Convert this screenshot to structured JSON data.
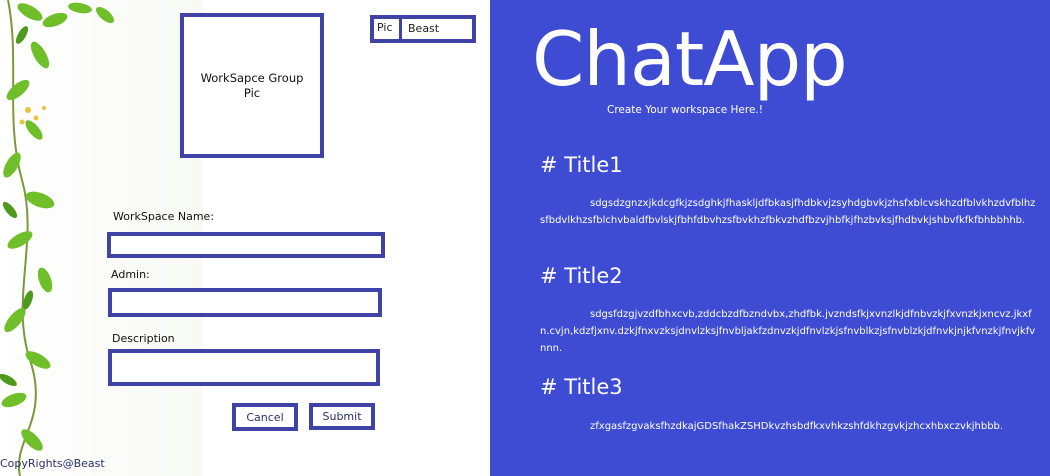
{
  "workspace": {
    "group_pic_text": "WorkSapce Group Pic",
    "profile": {
      "pic_label": "Pic",
      "name": "Beast"
    },
    "fields": {
      "name_label": "WorkSpace Name:",
      "admin_label": "Admin:",
      "description_label": "Description"
    },
    "buttons": {
      "cancel": "Cancel",
      "submit": "Submit"
    },
    "copyright": "CopyRights@Beast"
  },
  "info": {
    "app_title": "ChatApp",
    "tagline": "Create Your workspace Here.!",
    "sections": [
      {
        "title": "# Title1",
        "body": "sdgsdzgnzxjkdcgfkjzsdghkjfhaskljdfbkasjfhdbkvjzsyhdgbvkjzhsfxblcvskhzdfblvkhzdvfblhzsfbdvlkhzsfblchvbaldfbvlskjfbhfdbvhzsfbvkhzfbkvzhdfbzvjhbfkjfhzbvksjfhdbvkjshbvfkfkfbhbbhhb."
      },
      {
        "title": "# Title2",
        "body": "sdgsfdzgjvzdfbhxcvb,zddcbzdfbzndvbx,zhdfbk.jvzndsfkjxvnzlkjdfnbvzkjfxvnzkjxncvz.jkxfn.cvjn,kdzfjxnv.dzkjfnxvzksjdnvlzksjfnvbljakfzdnvzkjdfnvlzkjsfnvblkzjsfnvblzkjdfnvkjnjkfvnzkjfnvjkfvnnn."
      },
      {
        "title": "# Title3",
        "body": "zfxgasfzgvaksfhzdkajGDSfhakZSHDkvzhsbdfkxvhkzshfdkhzgvkjzhcxhbxczvkjhbbb."
      }
    ]
  },
  "colors": {
    "accent": "#4043a6",
    "panel_bg": "#3e4bd3",
    "leaf": "#6fbf2a"
  }
}
